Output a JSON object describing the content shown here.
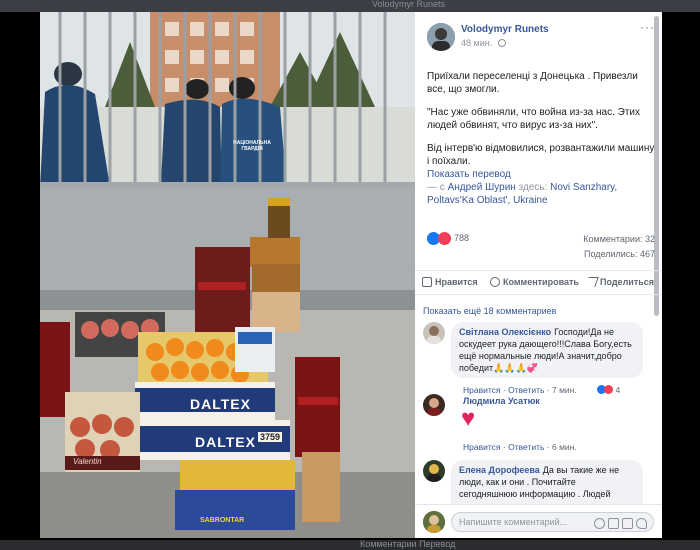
{
  "background": {
    "top_text": "Volodymyr Runets",
    "bottom_text": "Комментарии  Перевод"
  },
  "post": {
    "author": "Volodymyr Runets",
    "time": "48 мин.",
    "privacy_icon": "globe-icon",
    "paragraphs": [
      "Приїхали переселенці з Донецька . Привезли все, що змогли.",
      "\"Нас уже обвиняли, что война из-за нас. Этих людей обвинят, что вирус из-за них\".",
      "Від інтерв'ю відмовилися, розвантажили машину і поїхали."
    ],
    "translate_link": "Показать перевод",
    "tag_prefix": "— с",
    "tag_person": "Андрей Шурин",
    "tag_middle": "здесь:",
    "tag_place": "Novi Sanzhary, Poltavs'Ka Oblast', Ukraine",
    "reactions_count": "788",
    "comments_count": "Комментарии: 32",
    "shares_count": "Поделились: 467",
    "actions": {
      "like": "Нравится",
      "comment": "Комментировать",
      "share": "Поделиться"
    },
    "show_more_comments": "Показать ещё 18 комментариев"
  },
  "comments": [
    {
      "name": "Світлана Олексієнко",
      "text": "Господи!Да не оскудеет рука дающего!!!Слава Богу,есть ещё нормальные люди!А значит,добро победит",
      "emoji": "🙏🙏🙏💞",
      "like": "Нравится",
      "reply": "Ответить",
      "time": "7 мин.",
      "reactions": "4"
    },
    {
      "name": "Людмила Усатюк",
      "text": "♥",
      "like": "Нравится",
      "reply": "Ответить",
      "time": "6 мин."
    },
    {
      "name": "Елена Дорофеева",
      "text": "Да вы такие же не люди, как и они . Почитайте сегодняшнюю информацию . Людей"
    }
  ],
  "composer": {
    "placeholder": "Напишите комментарий..."
  },
  "photo": {
    "box_brand": "DALTEX",
    "box_brand_2": "DALTEX",
    "box_number": "3759",
    "box_label_valentine": "Valentin",
    "box_label_sabrontar": "SABRONTAR",
    "badge_text": "НАЦІОНАЛЬНА ГВАРДІЯ"
  }
}
